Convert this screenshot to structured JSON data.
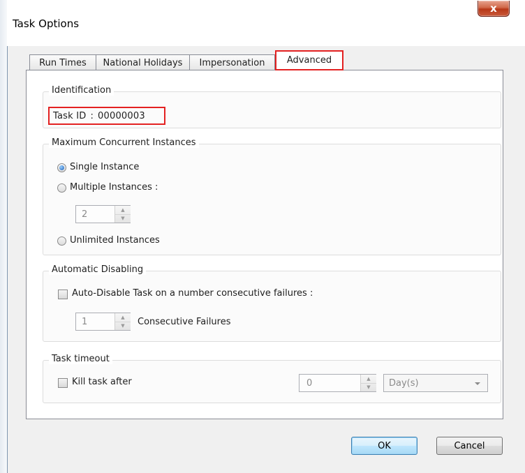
{
  "window": {
    "title": "Task Options",
    "close_glyph": "x"
  },
  "tabs": [
    {
      "label": "Run Times",
      "active": false
    },
    {
      "label": "National Holidays",
      "active": false
    },
    {
      "label": "Impersonation",
      "active": false
    },
    {
      "label": "Advanced",
      "active": true
    }
  ],
  "identification": {
    "legend": "Identification",
    "task_id_label": "Task ID",
    "separator": ":",
    "task_id_value": "00000003"
  },
  "concurrency": {
    "legend": "Maximum Concurrent Instances",
    "options": [
      {
        "label": "Single Instance",
        "checked": true
      },
      {
        "label": "Multiple Instances :",
        "checked": false
      },
      {
        "label": "Unlimited Instances",
        "checked": false
      }
    ],
    "instances_value": "2"
  },
  "auto_disable": {
    "legend": "Automatic Disabling",
    "checkbox_label": "Auto-Disable Task on a number consecutive failures :",
    "checked": false,
    "failures_value": "1",
    "failures_label": "Consecutive Failures"
  },
  "timeout": {
    "legend": "Task timeout",
    "checkbox_label": "Kill task after",
    "checked": false,
    "value": "0",
    "unit": "Day(s)"
  },
  "footer": {
    "ok_label": "OK",
    "cancel_label": "Cancel"
  },
  "icons": {
    "spin_up": "up-arrow-icon",
    "spin_down": "down-arrow-icon",
    "dropdown": "chevron-down-icon"
  }
}
